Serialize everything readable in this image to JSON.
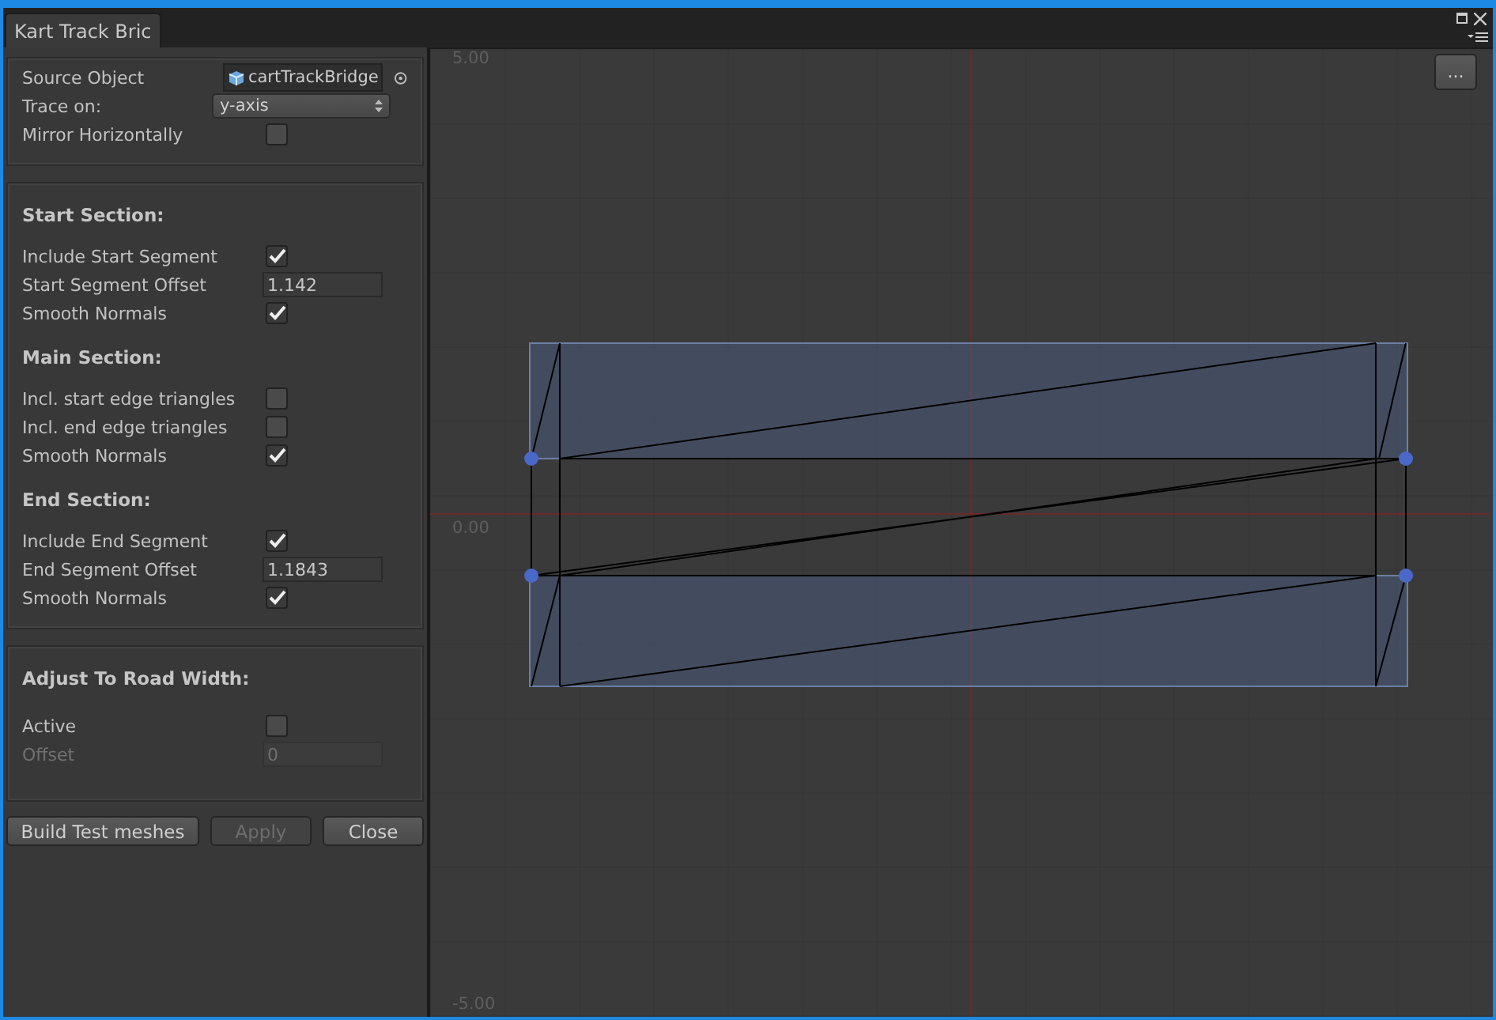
{
  "tab": {
    "title": "Kart Track Bric",
    "selected": true
  },
  "sections": [
    {
      "rows": [
        {
          "kind": "object",
          "label": "Source Object",
          "value": "cartTrackBridge"
        },
        {
          "kind": "dropdown",
          "label": "Trace on:",
          "value": "y-axis"
        },
        {
          "kind": "checkbox",
          "label": "Mirror Horizontally",
          "checked": false
        }
      ]
    },
    {
      "title": "Start Section:",
      "rows": [
        {
          "kind": "checkbox",
          "label": "Include Start Segment",
          "checked": true
        },
        {
          "kind": "number",
          "label": "Start Segment Offset",
          "value": "1.142",
          "disabled": false
        },
        {
          "kind": "checkbox",
          "label": "Smooth Normals",
          "checked": true
        }
      ],
      "groups": [
        {
          "title": "Main Section:",
          "rows": [
            {
              "kind": "checkbox",
              "label": "Incl. start edge triangles",
              "checked": false
            },
            {
              "kind": "checkbox",
              "label": "Incl. end edge triangles",
              "checked": false
            },
            {
              "kind": "checkbox",
              "label": "Smooth Normals",
              "checked": true
            }
          ]
        },
        {
          "title": "End Section:",
          "rows": [
            {
              "kind": "checkbox",
              "label": "Include End Segment",
              "checked": true
            },
            {
              "kind": "number",
              "label": "End Segment Offset",
              "value": "1.1843",
              "disabled": false
            },
            {
              "kind": "checkbox",
              "label": "Smooth Normals",
              "checked": true
            }
          ]
        }
      ]
    },
    {
      "title": "Adjust To Road Width:",
      "rows": [
        {
          "kind": "checkbox",
          "label": "Active",
          "checked": false
        },
        {
          "kind": "number",
          "label": "Offset",
          "value": "0",
          "disabled": true
        }
      ]
    }
  ],
  "buttons": [
    {
      "label": "Build Test meshes",
      "disabled": false
    },
    {
      "label": "Apply",
      "disabled": true
    },
    {
      "label": "Close",
      "disabled": false
    }
  ],
  "viewport": {
    "menu_button": "...",
    "axis_labels": [
      "5.00",
      "0.00",
      "-5.00"
    ]
  }
}
